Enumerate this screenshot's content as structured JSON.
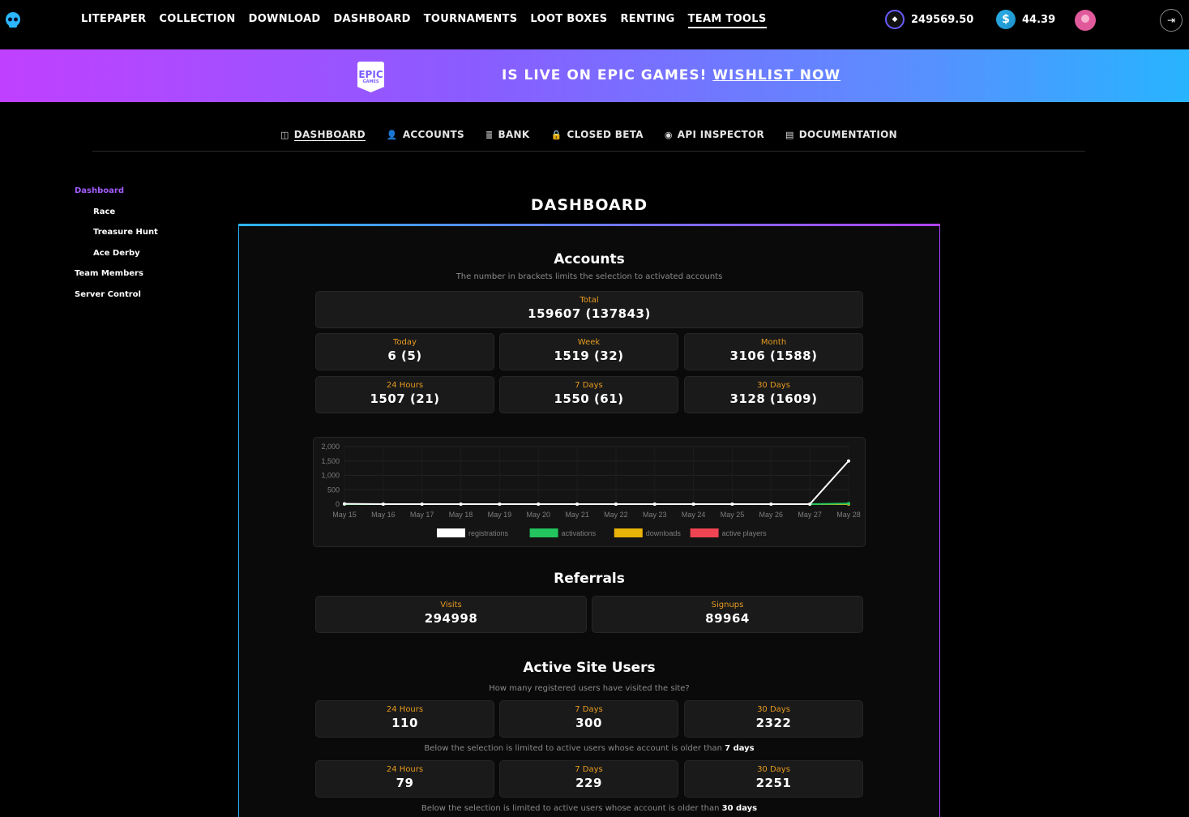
{
  "topnav": {
    "links": [
      "LITEPAPER",
      "COLLECTION",
      "DOWNLOAD",
      "DASHBOARD",
      "TOURNAMENTS",
      "LOOT BOXES",
      "RENTING",
      "TEAM TOOLS"
    ],
    "active": "TEAM TOOLS",
    "token_balance": "249569.50",
    "cash_balance": "44.39"
  },
  "banner": {
    "text": "IS LIVE ON EPIC GAMES!",
    "link": "WISHLIST NOW",
    "logo_text": "EPIC",
    "logo_sub": "GAMES"
  },
  "subnav": [
    {
      "icon": "dashboard-icon",
      "glyph": "◫",
      "label": "DASHBOARD"
    },
    {
      "icon": "user-icon",
      "glyph": "👤",
      "label": "ACCOUNTS"
    },
    {
      "icon": "coins-icon",
      "glyph": "≣",
      "label": "BANK"
    },
    {
      "icon": "lock-icon",
      "glyph": "🔒",
      "label": "CLOSED BETA"
    },
    {
      "icon": "eye-icon",
      "glyph": "◉",
      "label": "API INSPECTOR"
    },
    {
      "icon": "book-icon",
      "glyph": "▤",
      "label": "DOCUMENTATION"
    }
  ],
  "sidebar": [
    {
      "label": "Dashboard",
      "sub": false
    },
    {
      "label": "Race",
      "sub": true
    },
    {
      "label": "Treasure Hunt",
      "sub": true
    },
    {
      "label": "Ace Derby",
      "sub": true
    },
    {
      "label": "Team Members",
      "sub": false
    },
    {
      "label": "Server Control",
      "sub": false
    }
  ],
  "page_title": "DASHBOARD",
  "accounts": {
    "title": "Accounts",
    "subtitle": "The number in brackets limits the selection to activated accounts",
    "total_label": "Total",
    "total_value": "159607 (137843)",
    "cards": [
      {
        "label": "Today",
        "value": "6 (5)"
      },
      {
        "label": "Week",
        "value": "1519 (32)"
      },
      {
        "label": "Month",
        "value": "3106 (1588)"
      },
      {
        "label": "24 Hours",
        "value": "1507 (21)"
      },
      {
        "label": "7 Days",
        "value": "1550 (61)"
      },
      {
        "label": "30 Days",
        "value": "3128 (1609)"
      }
    ]
  },
  "chart_data": {
    "type": "line",
    "x": [
      "May 15",
      "May 16",
      "May 17",
      "May 18",
      "May 19",
      "May 20",
      "May 21",
      "May 22",
      "May 23",
      "May 24",
      "May 25",
      "May 26",
      "May 27",
      "May 28"
    ],
    "yticks": [
      "2,000",
      "1,500",
      "1,000",
      "500",
      "0"
    ],
    "ylim": [
      0,
      2000
    ],
    "series": [
      {
        "name": "registrations",
        "color": "#ffffff",
        "values": [
          10,
          0,
          0,
          0,
          0,
          0,
          0,
          0,
          0,
          0,
          0,
          0,
          0,
          1500
        ]
      },
      {
        "name": "activations",
        "color": "#22c55e",
        "values": [
          0,
          0,
          0,
          0,
          0,
          0,
          0,
          0,
          0,
          0,
          0,
          0,
          0,
          21
        ]
      },
      {
        "name": "downloads",
        "color": "#eab308",
        "values": [
          0,
          0,
          0,
          0,
          0,
          0,
          0,
          0,
          0,
          0,
          0,
          0,
          0,
          0
        ]
      },
      {
        "name": "active players",
        "color": "#ef4452",
        "values": [
          0,
          0,
          0,
          0,
          0,
          0,
          0,
          0,
          0,
          0,
          0,
          0,
          0,
          0
        ]
      }
    ],
    "legend": "bottom"
  },
  "referrals": {
    "title": "Referrals",
    "cards": [
      {
        "label": "Visits",
        "value": "294998"
      },
      {
        "label": "Signups",
        "value": "89964"
      }
    ]
  },
  "active_users": {
    "title": "Active Site Users",
    "subtitle": "How many registered users have visited the site?",
    "row1": [
      {
        "label": "24 Hours",
        "value": "110"
      },
      {
        "label": "7 Days",
        "value": "300"
      },
      {
        "label": "30 Days",
        "value": "2322"
      }
    ],
    "note1_prefix": "Below the selection is limited to active users whose account is older than",
    "note1_emph": "7 days",
    "row2": [
      {
        "label": "24 Hours",
        "value": "79"
      },
      {
        "label": "7 Days",
        "value": "229"
      },
      {
        "label": "30 Days",
        "value": "2251"
      }
    ],
    "note2_prefix": "Below the selection is limited to active users whose account is older than",
    "note2_emph": "30 days"
  },
  "colors": {
    "accent": "#a35cff",
    "label": "#e79b1f"
  }
}
